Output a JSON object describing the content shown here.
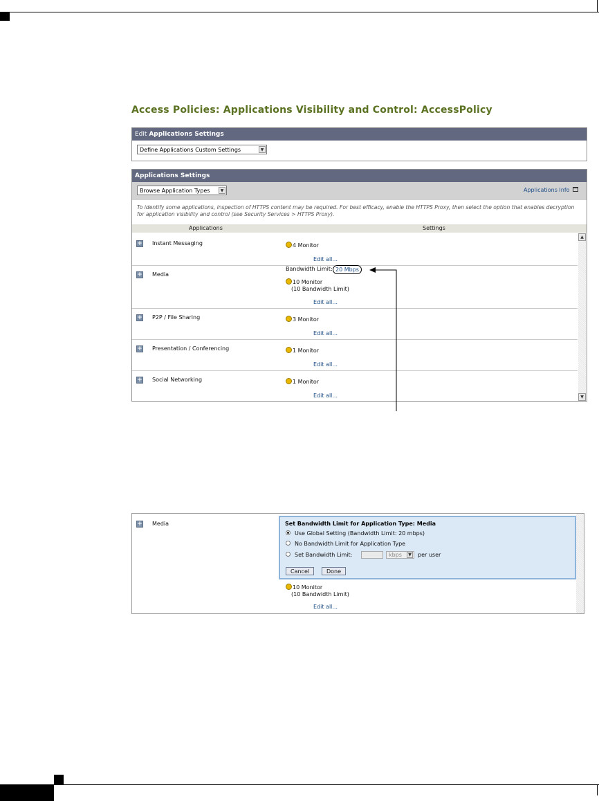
{
  "page_title": "Access Policies: Applications Visibility and Control: AccessPolicy",
  "edit_panel": {
    "header_prefix": "Edit",
    "header_bold": "Applications Settings",
    "select_value": "Define Applications Custom Settings"
  },
  "settings_panel": {
    "header": "Applications Settings",
    "browse_select_value": "Browse Application Types",
    "info_link": "Applications Info",
    "note": "To identify some applications, inspection of HTTPS content may be required. For best efficacy, enable the HTTPS Proxy, then select the option that enables decryption for application visibility and control (see Security Services > HTTPS Proxy).",
    "col_applications": "Applications",
    "col_settings": "Settings",
    "rows": [
      {
        "name": "Instant Messaging",
        "monitor": "4 Monitor",
        "edit": "Edit all..."
      },
      {
        "name": "Media",
        "bandwidth_label": "Bandwidth Limit:",
        "bandwidth_value": "20 Mbps",
        "monitor": "10 Monitor",
        "monitor_sub": "(10 Bandwidth Limit)",
        "edit": "Edit all..."
      },
      {
        "name": "P2P / File Sharing",
        "monitor": "3 Monitor",
        "edit": "Edit all..."
      },
      {
        "name": "Presentation / Conferencing",
        "monitor": "1 Monitor",
        "edit": "Edit all..."
      },
      {
        "name": "Social Networking",
        "monitor": "1 Monitor",
        "edit": "Edit all..."
      }
    ]
  },
  "media_panel": {
    "name": "Media",
    "dialog_title": "Set Bandwidth Limit for Application Type: Media",
    "option_global": "Use Global Setting (Bandwidth Limit: 20 mbps)",
    "option_none": "No Bandwidth Limit for Application Type",
    "option_set": "Set Bandwidth Limit:",
    "unit_value": "kbps",
    "per_user": "per user",
    "selected_option": "global",
    "cancel_label": "Cancel",
    "done_label": "Done",
    "monitor": "10 Monitor",
    "monitor_sub": "(10 Bandwidth Limit)",
    "edit": "Edit all..."
  },
  "icons": {
    "expand": "plus-icon",
    "monitor": "yellow-dot-icon",
    "dropdown": "chevron-down-icon",
    "popup": "popup-window-icon"
  },
  "colors": {
    "title": "#5b7222",
    "panel_header": "#616880",
    "link": "#1e4f86",
    "monitor_dot": "#e9b800",
    "dialog_bg": "#dbe8f6"
  }
}
